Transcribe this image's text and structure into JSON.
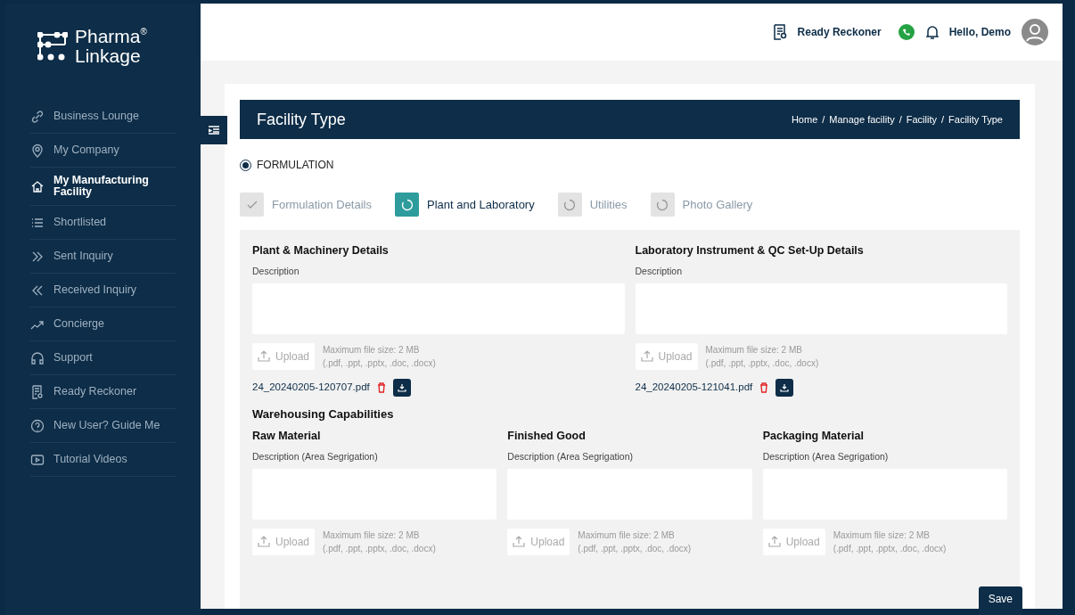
{
  "brand": {
    "line1": "Pharma",
    "line2": "Linkage",
    "mark": "®"
  },
  "sidebar": {
    "items": [
      {
        "label": "Business Lounge",
        "selected": false
      },
      {
        "label": "My Company",
        "selected": false
      },
      {
        "label": "My Manufacturing Facility",
        "selected": true
      },
      {
        "label": "Shortlisted",
        "selected": false
      },
      {
        "label": "Sent Inquiry",
        "selected": false
      },
      {
        "label": "Received Inquiry",
        "selected": false
      },
      {
        "label": "Concierge",
        "selected": false
      },
      {
        "label": "Support",
        "selected": false
      },
      {
        "label": "Ready Reckoner",
        "selected": false
      },
      {
        "label": "New User? Guide Me",
        "selected": false
      },
      {
        "label": "Tutorial Videos",
        "selected": false
      }
    ]
  },
  "topbar": {
    "link": "Ready Reckoner",
    "greeting": "Hello, Demo"
  },
  "header": {
    "title": "Facility Type",
    "breadcrumb": [
      "Home",
      "Manage facility",
      "Facility",
      "Facility Type"
    ],
    "separator": "/"
  },
  "facility_type": {
    "label": "FORMULATION",
    "selected": true
  },
  "steps": [
    {
      "label": "Formulation Details",
      "kind": "done"
    },
    {
      "label": "Plant and Laboratory",
      "kind": "active"
    },
    {
      "label": "Utilities",
      "kind": "pending"
    },
    {
      "label": "Photo Gallery",
      "kind": "pending"
    }
  ],
  "sections": [
    {
      "title": "Plant & Machinery Details",
      "field_label": "Description",
      "upload": "Upload",
      "hint1": "Maximum file size: 2 MB",
      "hint2": "(.pdf, .ppt, .pptx, .doc, .docx)",
      "file": "24_20240205-120707.pdf"
    },
    {
      "title": "Laboratory Instrument & QC Set-Up Details",
      "field_label": "Description",
      "upload": "Upload",
      "hint1": "Maximum file size: 2 MB",
      "hint2": "(.pdf, .ppt, .pptx, .doc, .docx)",
      "file": "24_20240205-121041.pdf"
    }
  ],
  "warehousing": {
    "title": "Warehousing Capabilities",
    "items": [
      {
        "title": "Raw Material",
        "field_label": "Description (Area Segrigation)",
        "upload": "Upload",
        "hint1": "Maximum file size: 2 MB",
        "hint2": "(.pdf, .ppt, .pptx, .doc, .docx)"
      },
      {
        "title": "Finished Good",
        "field_label": "Description (Area Segrigation)",
        "upload": "Upload",
        "hint1": "Maximum file size: 2 MB",
        "hint2": "(.pdf, .ppt, .pptx, .doc, .docx)"
      },
      {
        "title": "Packaging Material",
        "field_label": "Description (Area Segrigation)",
        "upload": "Upload",
        "hint1": "Maximum file size: 2 MB",
        "hint2": "(.pdf, .ppt, .pptx, .doc, .docx)"
      }
    ]
  },
  "save_button": "Save"
}
